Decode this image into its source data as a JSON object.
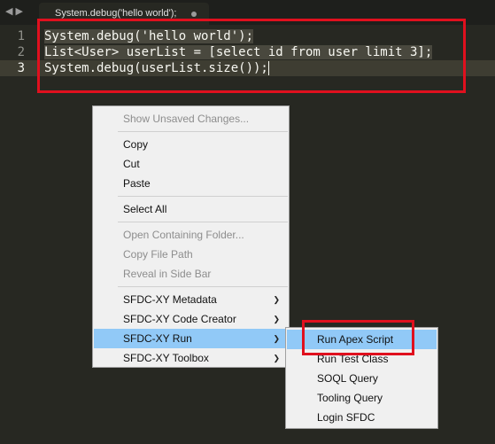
{
  "tab": {
    "title": "System.debug('hello world');",
    "nav_back": "◀",
    "nav_forward": "▶"
  },
  "editor": {
    "lines": [
      {
        "num": "1",
        "text": "System.debug('hello world');"
      },
      {
        "num": "2",
        "text": "List<User> userList = [select id from user limit 3];"
      },
      {
        "num": "3",
        "text": "System.debug(userList.size());"
      }
    ]
  },
  "context_menu": {
    "items": [
      {
        "label": "Show Unsaved Changes...",
        "disabled": true
      },
      {
        "label": "Copy"
      },
      {
        "label": "Cut"
      },
      {
        "label": "Paste"
      },
      {
        "label": "Select All"
      },
      {
        "label": "Open Containing Folder...",
        "disabled": true
      },
      {
        "label": "Copy File Path",
        "disabled": true
      },
      {
        "label": "Reveal in Side Bar",
        "disabled": true
      },
      {
        "label": "SFDC-XY Metadata",
        "submenu": true
      },
      {
        "label": "SFDC-XY Code Creator",
        "submenu": true
      },
      {
        "label": "SFDC-XY Run",
        "submenu": true,
        "selected": true
      },
      {
        "label": "SFDC-XY Toolbox",
        "submenu": true
      }
    ],
    "submenu_arrow": "❯"
  },
  "submenu": {
    "items": [
      {
        "label": "Run Apex Script",
        "selected": true
      },
      {
        "label": "Run Test Class"
      },
      {
        "label": "SOQL Query"
      },
      {
        "label": "Tooling Query"
      },
      {
        "label": "Login SFDC"
      }
    ]
  },
  "colors": {
    "editor_bg": "#272822",
    "highlight_box": "#e0101e",
    "menu_selected": "#91c9f7"
  }
}
